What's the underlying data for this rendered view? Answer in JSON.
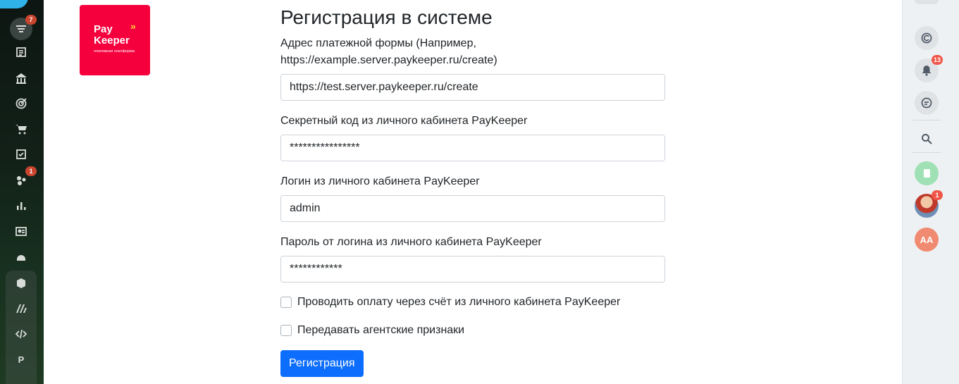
{
  "sidebar": {
    "badges": {
      "filter": "7",
      "groups": "1"
    },
    "letter": "P"
  },
  "logo": {
    "line1": "Pay",
    "line2": "Keeper",
    "tagline": "платежная платформа",
    "chevron": "»"
  },
  "form": {
    "title": "Регистрация в системе",
    "url": {
      "label": "Адрес платежной формы (Например, https://example.server.paykeeper.ru/create)",
      "value": "https://test.server.paykeeper.ru/create"
    },
    "secret": {
      "label": "Секретный код из личного кабинета PayKeeper",
      "value": "****************"
    },
    "login": {
      "label": "Логин из личного кабинета PayKeeper",
      "value": "admin"
    },
    "password": {
      "label": "Пароль от логина из личного кабинета PayKeeper",
      "value": "************"
    },
    "check_invoice": "Проводить оплату через счёт из личного кабинета PayKeeper",
    "check_agent": "Передавать агентские признаки",
    "submit": "Регистрация"
  },
  "right_panel": {
    "notifications_badge": "13",
    "avatar_badge": "1",
    "user_initials": "AA"
  },
  "colors": {
    "accent": "#0d6efd",
    "brand": "#f5003d",
    "badge": "#f0564a"
  }
}
